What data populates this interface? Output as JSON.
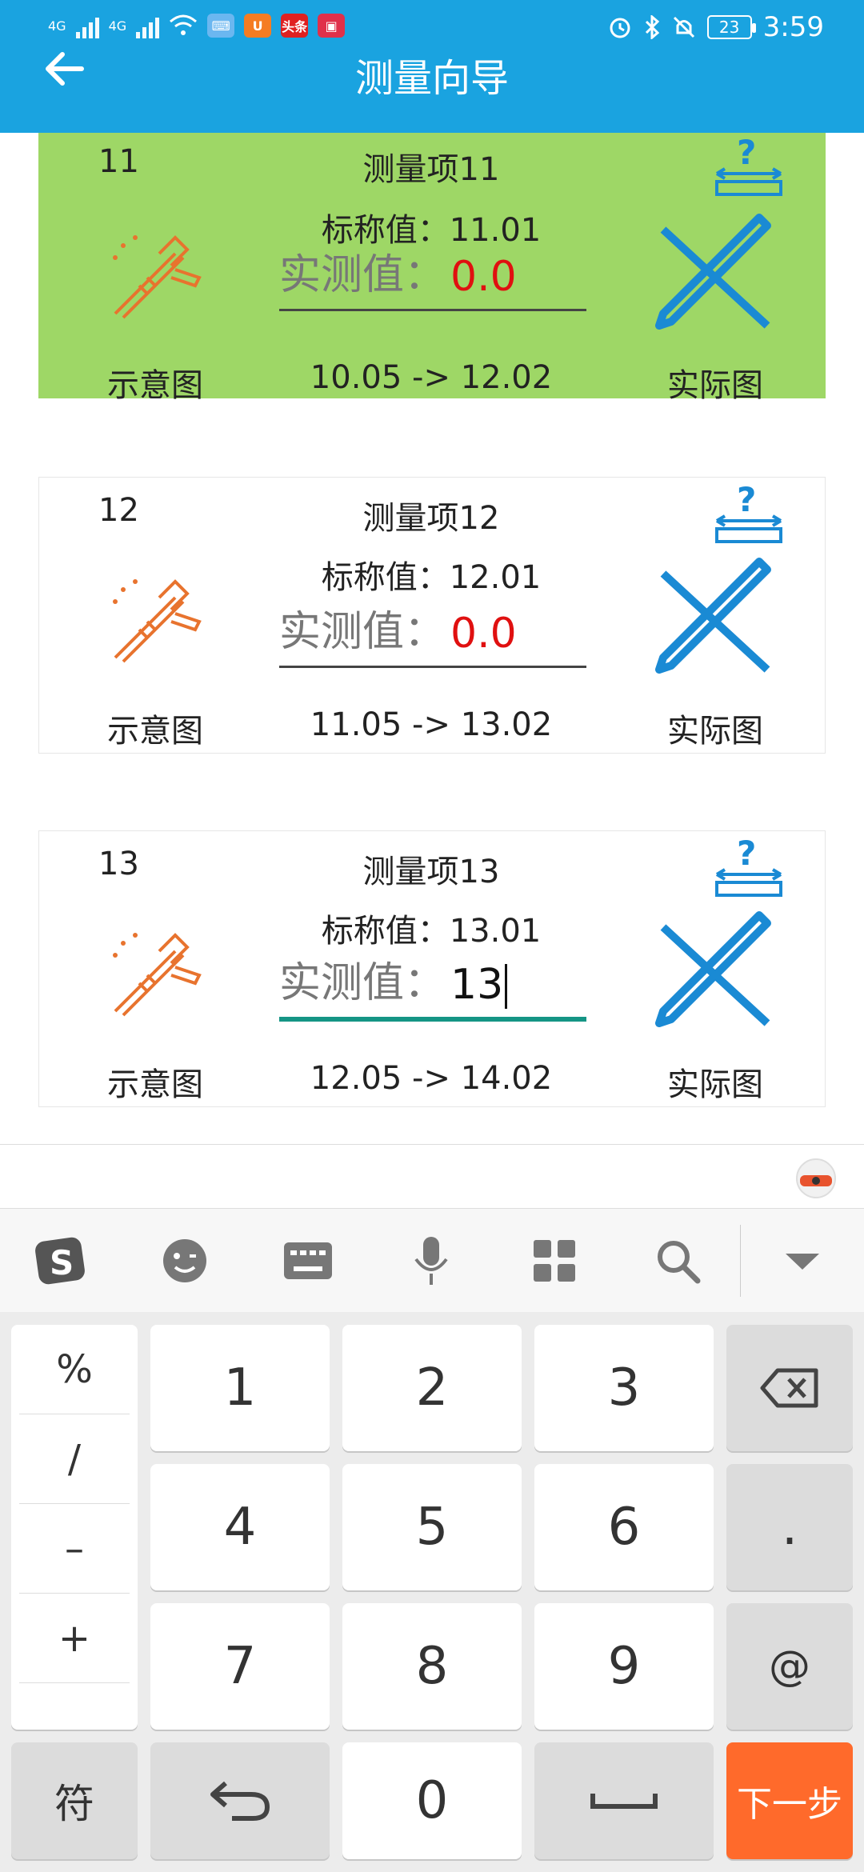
{
  "status": {
    "time": "3:59",
    "battery": "23",
    "net1": "4G",
    "net2": "4G",
    "app_badge": "头条"
  },
  "header": {
    "title": "测量向导"
  },
  "cards": [
    {
      "num": "11",
      "name": "测量项11",
      "nominal": "标称值：11.01",
      "measure_label": "实测值：",
      "measure_value": "0.0",
      "range": "10.05 -> 12.02",
      "illus_label": "示意图",
      "actual_label": "实际图"
    },
    {
      "num": "12",
      "name": "测量项12",
      "nominal": "标称值：12.01",
      "measure_label": "实测值：",
      "measure_value": "0.0",
      "range": "11.05 -> 13.02",
      "illus_label": "示意图",
      "actual_label": "实际图"
    },
    {
      "num": "13",
      "name": "测量项13",
      "nominal": "标称值：13.01",
      "measure_label": "实测值：",
      "measure_value": "13",
      "range": "12.05 -> 14.02",
      "illus_label": "示意图",
      "actual_label": "实际图"
    }
  ],
  "keyboard": {
    "side": [
      "%",
      "/",
      "–",
      "+"
    ],
    "digits": [
      "1",
      "2",
      "3",
      "4",
      "5",
      "6",
      "7",
      "8",
      "9",
      "0"
    ],
    "dot": ".",
    "at": "@",
    "symbols": "符",
    "next": "下一步"
  },
  "colors": {
    "appbar": "#1aa3e0",
    "active_card": "#9ed766",
    "measure_zero": "#e01010",
    "focus_line": "#159585",
    "next_key": "#ff6a2b"
  }
}
